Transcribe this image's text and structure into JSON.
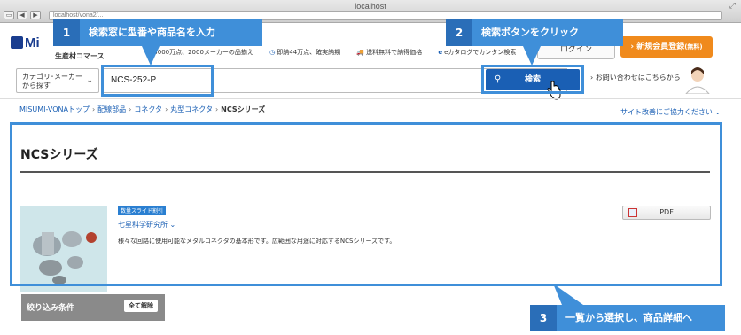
{
  "browser": {
    "title": "localhost",
    "url": "localhost/vona2/..."
  },
  "header": {
    "logo": "Mi",
    "tagline": "生産材コマース",
    "features": [
      {
        "icon": "★",
        "text": "3000万点、2000メーカーの品揃え"
      },
      {
        "icon": "◷",
        "text": "即納44万点、確実納期"
      },
      {
        "icon": "🚚",
        "text": "送料無料で納得価格"
      },
      {
        "icon": "e",
        "text": "eカタログでカンタン検索"
      }
    ],
    "login_label": "ログイン",
    "register_label": "新規会員登録",
    "register_small": "(無料)"
  },
  "search": {
    "category_label_1": "カテゴリ･メーカー",
    "category_label_2": "から探す",
    "value": "NCS-252-P",
    "button_label": "検索",
    "contact_label": "お問い合わせはこちらから"
  },
  "breadcrumb": {
    "items": [
      "MISUMI-VONAトップ",
      "配線部品",
      "コネクタ",
      "丸型コネクタ"
    ],
    "current": "NCSシリーズ",
    "improve_link": "サイト改善にご協力ください"
  },
  "product": {
    "title": "NCSシリーズ",
    "badge": "数量スライド割引",
    "brand": "七星科学研究所",
    "description": "様々な回路に使用可能なメタルコネクタの基本形です。広範囲な用途に対応するNCSシリーズです。",
    "pdf_label": "PDF"
  },
  "filter": {
    "title": "絞り込み条件",
    "clear_label": "全て解除"
  },
  "callouts": [
    {
      "num": "1",
      "text": "検索窓に型番や商品名を入力"
    },
    {
      "num": "2",
      "text": "検索ボタンをクリック"
    },
    {
      "num": "3",
      "text": "一覧から選択し、商品詳細へ"
    }
  ],
  "colors": {
    "accent": "#3f8fd9",
    "brand_blue": "#1a5fb4",
    "register_orange": "#f08a1c"
  }
}
